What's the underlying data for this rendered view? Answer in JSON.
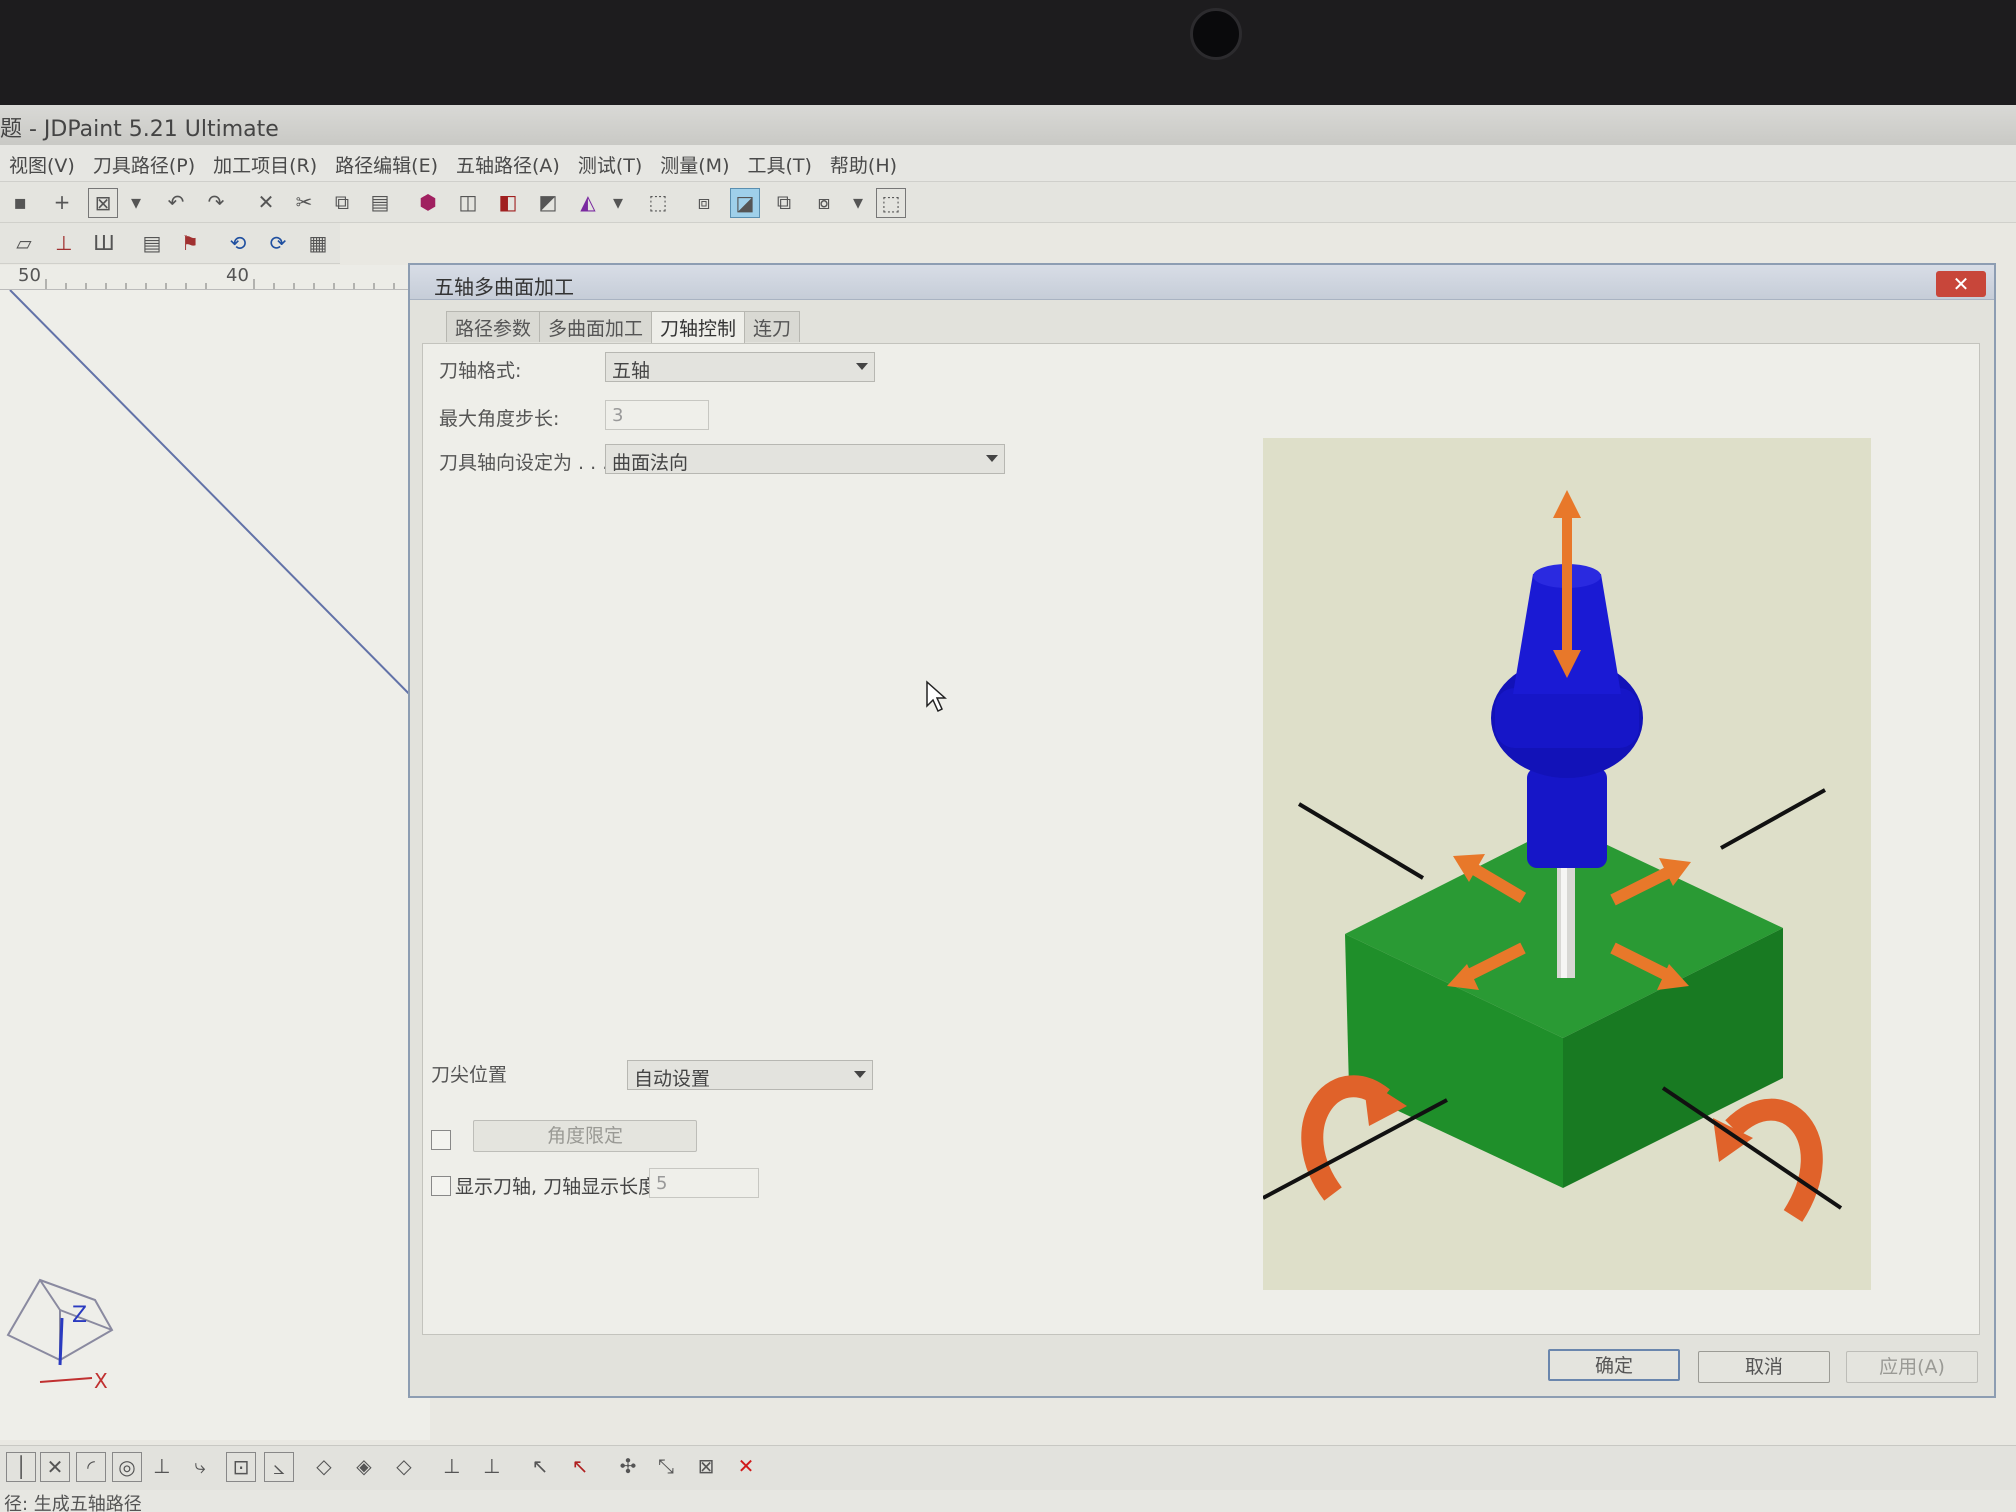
{
  "window": {
    "title": "题 - JDPaint 5.21 Ultimate"
  },
  "menu": [
    "视图(V)",
    "刀具路径(P)",
    "加工项目(R)",
    "路径编辑(E)",
    "五轴路径(A)",
    "测试(T)",
    "测量(M)",
    "工具(T)",
    "帮助(H)"
  ],
  "ruler": {
    "left_label": "50",
    "right_label": "40"
  },
  "dialog": {
    "title": "五轴多曲面加工",
    "tabs": [
      "路径参数",
      "多曲面加工",
      "刀轴控制",
      "连刀"
    ],
    "active_tab": "刀轴控制",
    "axis_format_label": "刀轴格式:",
    "axis_format_value": "五轴",
    "max_angle_step_label": "最大角度步长:",
    "max_angle_step_value": "3",
    "tool_axis_label": "刀具轴向设定为 . . .",
    "tool_axis_value": "曲面法向",
    "tip_position_label": "刀尖位置",
    "tip_position_value": "自动设置",
    "angle_limit_button": "角度限定",
    "show_axis_label": "显示刀轴, 刀轴显示长度",
    "show_axis_length": "5",
    "ok_button": "确定",
    "cancel_button": "取消",
    "apply_button": "应用(A)"
  },
  "axes_gizmo": {
    "z_label": "Z",
    "x_label": "X"
  },
  "status_bar": "径: 生成五轴路径",
  "colors": {
    "tool_blue": "#1414c8",
    "block_green": "#1f8f2a",
    "arrow_orange": "#e8782a"
  }
}
